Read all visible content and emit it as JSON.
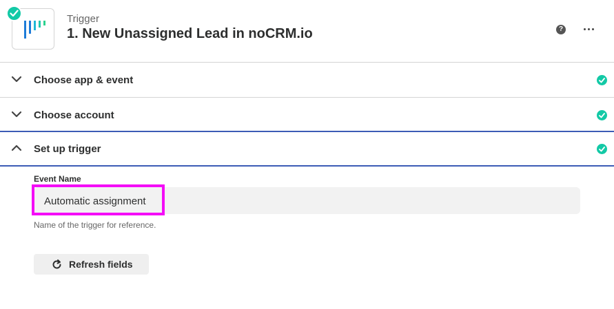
{
  "header": {
    "step_kind": "Trigger",
    "step_title": "1. New Unassigned Lead in noCRM.io",
    "app_icon": "nocrm-logo-icon",
    "status_icon": "check-circle-icon",
    "help_glyph": "?",
    "more_icon": "ellipsis-icon"
  },
  "sections": [
    {
      "label": "Choose app & event",
      "state": "collapsed",
      "status": "complete"
    },
    {
      "label": "Choose account",
      "state": "collapsed",
      "status": "complete"
    },
    {
      "label": "Set up trigger",
      "state": "expanded",
      "status": "complete"
    }
  ],
  "form": {
    "event_name_label": "Event Name",
    "event_name_value": "Automatic assignment",
    "event_name_help": "Name of the trigger for reference."
  },
  "actions": {
    "refresh_label": "Refresh fields",
    "refresh_icon": "refresh-icon"
  },
  "colors": {
    "success": "#13c9a6",
    "active_border": "#3b5bb5",
    "highlight": "#f40df7"
  }
}
